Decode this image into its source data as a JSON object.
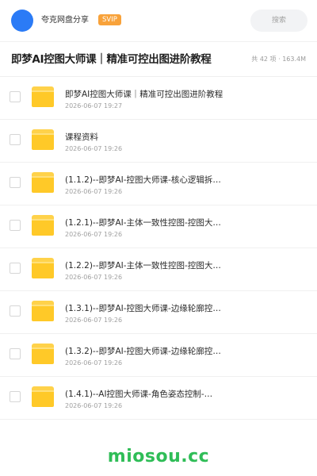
{
  "header": {
    "brand": "夸克网盘分享",
    "badge": "SVIP",
    "search_placeholder": "搜索"
  },
  "title_bar": {
    "title": "即梦AI控图大师课｜精准可控出图进阶教程",
    "meta": "共 42 项 · 163.4M"
  },
  "files": [
    {
      "name": "即梦AI控图大师课｜精准可控出图进阶教程",
      "date": "2026-06-07 19:27"
    },
    {
      "name": "课程资料",
      "date": "2026-06-07 19:26"
    },
    {
      "name": "(1.1.2)--即梦AI-控图大师课-核心逻辑拆…",
      "date": "2026-06-07 19:26"
    },
    {
      "name": "(1.2.1)--即梦AI-主体一致性控图-控图大…",
      "date": "2026-06-07 19:26"
    },
    {
      "name": "(1.2.2)--即梦AI-主体一致性控图-控图大…",
      "date": "2026-06-07 19:26"
    },
    {
      "name": "(1.3.1)--即梦AI-控图大师课-边缘轮廓控…",
      "date": "2026-06-07 19:26"
    },
    {
      "name": "(1.3.2)--即梦AI-控图大师课-边缘轮廓控…",
      "date": "2026-06-07 19:26"
    },
    {
      "name": "(1.4.1)--AI控图大师课-角色姿态控制-…",
      "date": "2026-06-07 19:26"
    }
  ],
  "footer": {
    "watermark": "miosou.cc"
  },
  "colors": {
    "accent": "#2b7bf6",
    "badge": "#f8a23a",
    "folder": "#ffc928",
    "watermark": "#2fbd57"
  },
  "icons": {
    "avatar": "avatar-circle",
    "folder": "folder-icon",
    "checkbox": "checkbox-icon"
  }
}
